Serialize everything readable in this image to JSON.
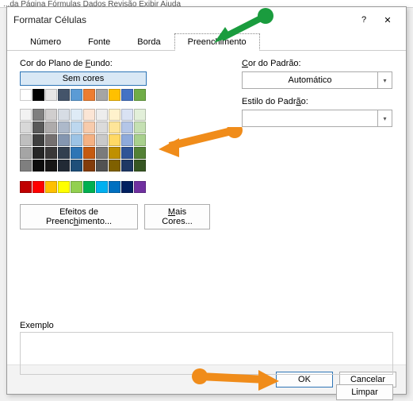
{
  "ribbon_hint": "...da Página   Fórmulas   Dados   Revisão   Exibir   Ajuda",
  "dialog": {
    "title": "Formatar Células",
    "help": "?",
    "close": "✕"
  },
  "tabs": {
    "numero": "Número",
    "fonte": "Fonte",
    "borda": "Borda",
    "preenchimento": "Preenchimento"
  },
  "fill": {
    "bg_label_pre": "Cor do Plano de ",
    "bg_label_u": "F",
    "bg_label_post": "undo:",
    "no_color": "Sem cores",
    "effects_pre": "Efeitos de Preenc",
    "effects_u": "h",
    "effects_post": "imento...",
    "more_pre": "",
    "more_u": "M",
    "more_post": "ais Cores...",
    "theme_colors": [
      "#FFFFFF",
      "#000000",
      "#E7E6E6",
      "#44546A",
      "#5B9BD5",
      "#ED7D31",
      "#A5A5A5",
      "#FFC000",
      "#4472C4",
      "#70AD47"
    ],
    "tint_rows": [
      [
        "#F2F2F2",
        "#7F7F7F",
        "#D0CECE",
        "#D6DCE4",
        "#DEEBF6",
        "#FBE5D5",
        "#EDEDED",
        "#FFF2CC",
        "#D9E2F3",
        "#E2EFD9"
      ],
      [
        "#D8D8D8",
        "#595959",
        "#AEABAB",
        "#ADB9CA",
        "#BDD7EE",
        "#F7CBAC",
        "#DBDBDB",
        "#FEE599",
        "#B4C6E7",
        "#C5E0B3"
      ],
      [
        "#BFBFBF",
        "#3F3F3F",
        "#757070",
        "#8496B0",
        "#9CC3E5",
        "#F4B183",
        "#C9C9C9",
        "#FFD965",
        "#8EAADB",
        "#A8D08D"
      ],
      [
        "#A5A5A5",
        "#262626",
        "#3A3838",
        "#323F4F",
        "#2E75B5",
        "#C55A11",
        "#7B7B7B",
        "#BF9000",
        "#2F5496",
        "#538135"
      ],
      [
        "#7F7F7F",
        "#0C0C0C",
        "#171616",
        "#222A35",
        "#1E4E79",
        "#833C0B",
        "#525252",
        "#7F6000",
        "#1F3864",
        "#375623"
      ]
    ],
    "standard_colors": [
      "#C00000",
      "#FF0000",
      "#FFC000",
      "#FFFF00",
      "#92D050",
      "#00B050",
      "#00B0F0",
      "#0070C0",
      "#002060",
      "#7030A0"
    ]
  },
  "pattern": {
    "color_label_u": "C",
    "color_label_post": "or do Padrão:",
    "color_value": "Automático",
    "style_label_pre": "Estilo do Padr",
    "style_label_u": "ã",
    "style_label_post": "o:"
  },
  "example": {
    "label": "Exemplo"
  },
  "buttons": {
    "clear": "Limpar",
    "ok": "OK",
    "cancel": "Cancelar"
  }
}
